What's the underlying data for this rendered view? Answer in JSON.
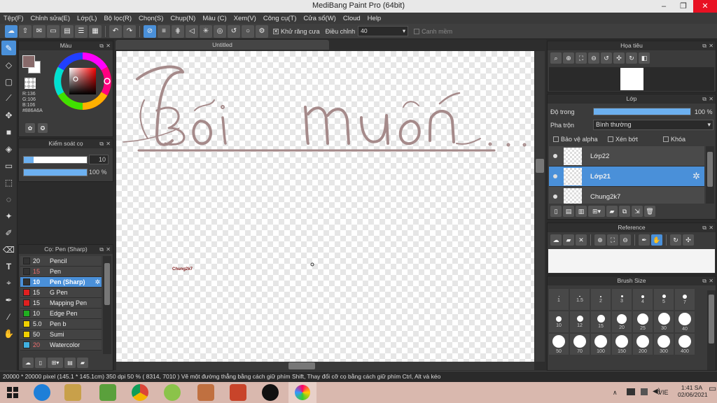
{
  "window": {
    "title": "MediBang Paint Pro (64bit)",
    "minimize": "–",
    "maximize": "❐",
    "close": "✕"
  },
  "menu": [
    "Tệp(F)",
    "Chỉnh sửa(E)",
    "Lớp(L)",
    "Bộ lọc(R)",
    "Chọn(S)",
    "Chụp(N)",
    "Màu (C)",
    "Xem(V)",
    "Công cụ(T)",
    "Cửa sổ(W)",
    "Cloud",
    "Help"
  ],
  "toolbar": {
    "antialias_label": "Khử răng cưa",
    "antialias_checked": "✕",
    "adjust_label": "Điều chỉnh",
    "adjust_value": "40",
    "snap_label": "Canh mềm"
  },
  "color_panel": {
    "title": "Màu",
    "r": "R:136",
    "g": "G:106",
    "b": "B:106",
    "hex": "#886A6A",
    "primary": "#886A6A"
  },
  "brush_control": {
    "title": "Kiểm soát cọ",
    "size": "10",
    "opacity": "100 %",
    "size_fill": 0.15,
    "opacity_fill": 1.0
  },
  "brush_list": {
    "title": "Cọ: Pen (Sharp)",
    "items": [
      {
        "size": "20",
        "name": "Pencil",
        "color": "#333333"
      },
      {
        "size": "15",
        "name": "Pen",
        "color": "#333333"
      },
      {
        "size": "10",
        "name": "Pen (Sharp)",
        "color": "#333333",
        "selected": true
      },
      {
        "size": "15",
        "name": "G Pen",
        "color": "#e02020"
      },
      {
        "size": "15",
        "name": "Mapping Pen",
        "color": "#e02020"
      },
      {
        "size": "10",
        "name": "Edge Pen",
        "color": "#20b020"
      },
      {
        "size": "5.0",
        "name": "Pen b",
        "color": "#f0d000"
      },
      {
        "size": "50",
        "name": "Sumi",
        "color": "#f0d000"
      },
      {
        "size": "20",
        "name": "Watercolor",
        "color": "#40b0e0"
      }
    ]
  },
  "document": {
    "tab": "Untitled",
    "stamp": "Chung2k7"
  },
  "navigator": {
    "title": "Họa tiêu"
  },
  "layers": {
    "title": "Lớp",
    "opacity_label": "Độ trong",
    "opacity_value": "100 %",
    "blend_label": "Pha trộn",
    "blend_value": "Bình thường",
    "protect_alpha": "Bảo vệ alpha",
    "clipping": "Xén bớt",
    "lock": "Khóa",
    "items": [
      {
        "name": "Lớp22",
        "selected": false
      },
      {
        "name": "Lớp21",
        "selected": true
      },
      {
        "name": "Chung2k7",
        "selected": false
      }
    ]
  },
  "reference": {
    "title": "Reference"
  },
  "brush_size": {
    "title": "Brush Size",
    "sizes": [
      "1",
      "1.5",
      "2",
      "3",
      "4",
      "5",
      "7",
      "10",
      "12",
      "15",
      "20",
      "25",
      "30",
      "40",
      "50",
      "70",
      "100",
      "150",
      "200",
      "300",
      "400"
    ]
  },
  "status": {
    "text": "20000 * 20000 pixel   (145.1 * 145.1cm)   350 dpi   50 %   ( 8314, 7010 )   Vẽ một đường thẳng bằng cách giữ phím Shift, Thay đổi cỡ cọ bằng cách giữ phím Ctrl, Alt và kéo"
  },
  "taskbar": {
    "lang": "VIE",
    "time": "1:41 SA",
    "date": "02/06/2021"
  }
}
